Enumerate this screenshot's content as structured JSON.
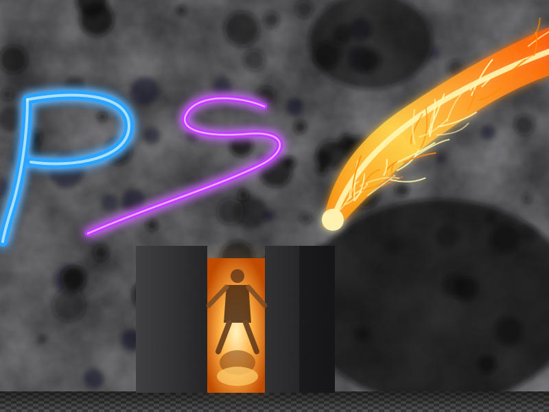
{
  "scene": {
    "letters": [
      {
        "name": "letter-p",
        "glyph": "P",
        "color": "#2aa4ff"
      },
      {
        "name": "letter-s",
        "glyph": "S",
        "color": "#c23cff"
      }
    ],
    "fire_color": "#ff8a00",
    "fire_core_color": "#fff6b0",
    "portal_glow_color": "#ffb347",
    "icons": [
      "fire-comet-icon",
      "human-figure-icon"
    ]
  }
}
